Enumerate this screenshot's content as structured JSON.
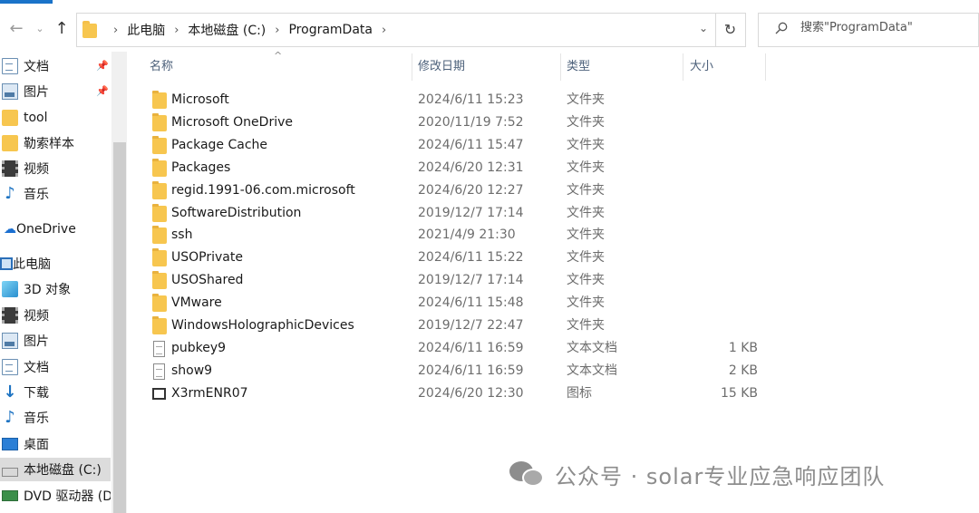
{
  "address_bar": {
    "crumbs": [
      "此电脑",
      "本地磁盘 (C:)",
      "ProgramData"
    ],
    "search_placeholder": "搜索\"ProgramData\""
  },
  "sidebar": {
    "items": [
      {
        "label": "文档",
        "icon": "document-icon",
        "pinned": true
      },
      {
        "label": "图片",
        "icon": "picture-icon",
        "pinned": true
      },
      {
        "label": "tool",
        "icon": "folder-icon"
      },
      {
        "label": "勒索样本",
        "icon": "folder-icon"
      },
      {
        "label": "视频",
        "icon": "video-icon"
      },
      {
        "label": "音乐",
        "icon": "music-icon"
      },
      {
        "label": "OneDrive",
        "icon": "cloud-icon"
      },
      {
        "label": "此电脑",
        "icon": "computer-icon"
      },
      {
        "label": "3D 对象",
        "icon": "3d-objects-icon"
      },
      {
        "label": "视频",
        "icon": "video-icon"
      },
      {
        "label": "图片",
        "icon": "picture-icon"
      },
      {
        "label": "文档",
        "icon": "document-icon"
      },
      {
        "label": "下载",
        "icon": "download-icon"
      },
      {
        "label": "音乐",
        "icon": "music-icon"
      },
      {
        "label": "桌面",
        "icon": "desktop-icon"
      },
      {
        "label": "本地磁盘 (C:)",
        "icon": "drive-icon",
        "selected": true
      },
      {
        "label": "DVD 驱动器 (D:",
        "icon": "dvd-icon"
      }
    ]
  },
  "columns": {
    "name": "名称",
    "date": "修改日期",
    "type": "类型",
    "size": "大小"
  },
  "files": [
    {
      "name": "Microsoft",
      "date": "2024/6/11 15:23",
      "type": "文件夹",
      "size": "",
      "kind": "folder"
    },
    {
      "name": "Microsoft OneDrive",
      "date": "2020/11/19 7:52",
      "type": "文件夹",
      "size": "",
      "kind": "folder"
    },
    {
      "name": "Package Cache",
      "date": "2024/6/11 15:47",
      "type": "文件夹",
      "size": "",
      "kind": "folder"
    },
    {
      "name": "Packages",
      "date": "2024/6/20 12:31",
      "type": "文件夹",
      "size": "",
      "kind": "folder"
    },
    {
      "name": "regid.1991-06.com.microsoft",
      "date": "2024/6/20 12:27",
      "type": "文件夹",
      "size": "",
      "kind": "folder"
    },
    {
      "name": "SoftwareDistribution",
      "date": "2019/12/7 17:14",
      "type": "文件夹",
      "size": "",
      "kind": "folder"
    },
    {
      "name": "ssh",
      "date": "2021/4/9 21:30",
      "type": "文件夹",
      "size": "",
      "kind": "folder"
    },
    {
      "name": "USOPrivate",
      "date": "2024/6/11 15:22",
      "type": "文件夹",
      "size": "",
      "kind": "folder"
    },
    {
      "name": "USOShared",
      "date": "2019/12/7 17:14",
      "type": "文件夹",
      "size": "",
      "kind": "folder"
    },
    {
      "name": "VMware",
      "date": "2024/6/11 15:48",
      "type": "文件夹",
      "size": "",
      "kind": "folder"
    },
    {
      "name": "WindowsHolographicDevices",
      "date": "2019/12/7 22:47",
      "type": "文件夹",
      "size": "",
      "kind": "folder"
    },
    {
      "name": "pubkey9",
      "date": "2024/6/11 16:59",
      "type": "文本文档",
      "size": "1 KB",
      "kind": "file"
    },
    {
      "name": "show9",
      "date": "2024/6/11 16:59",
      "type": "文本文档",
      "size": "2 KB",
      "kind": "file"
    },
    {
      "name": "X3rmENR07",
      "date": "2024/6/20 12:30",
      "type": "图标",
      "size": "15 KB",
      "kind": "app"
    }
  ],
  "watermark": {
    "text": "公众号 · solar专业应急响应团队"
  }
}
